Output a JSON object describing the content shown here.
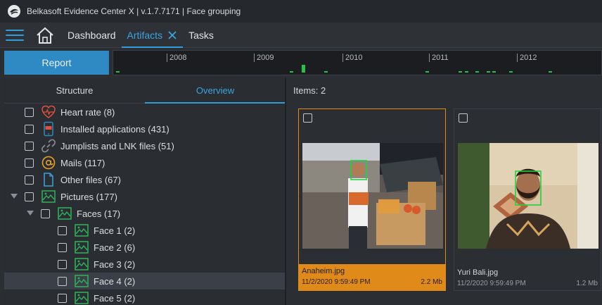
{
  "window": {
    "title": "Belkasoft Evidence Center X | v.1.7.7171 | Face grouping"
  },
  "nav": {
    "tabs": [
      {
        "label": "Dashboard"
      },
      {
        "label": "Artifacts"
      },
      {
        "label": "Tasks"
      }
    ]
  },
  "toolbar": {
    "report_label": "Report"
  },
  "timeline": {
    "years": [
      "2008",
      "2009",
      "2010",
      "2011",
      "2012"
    ],
    "bar_color": "#25c24a"
  },
  "left": {
    "tabs": [
      {
        "label": "Structure"
      },
      {
        "label": "Overview"
      }
    ],
    "tree": [
      {
        "label": "Heart rate (8)"
      },
      {
        "label": "Installed applications (431)"
      },
      {
        "label": "Jumplists and LNK files (51)"
      },
      {
        "label": "Mails (117)"
      },
      {
        "label": "Other files (67)"
      },
      {
        "label": "Pictures (177)"
      },
      {
        "label": "Faces (17)"
      },
      {
        "label": "Face 1 (2)"
      },
      {
        "label": "Face 2 (6)"
      },
      {
        "label": "Face 3 (2)"
      },
      {
        "label": "Face 4 (2)"
      },
      {
        "label": "Face 5 (2)"
      }
    ]
  },
  "right": {
    "items_label": "Items: 2",
    "cards": [
      {
        "filename": "Anaheim.jpg",
        "date": "11/2/2020 9:59:49 PM",
        "size": "2.2 Mb"
      },
      {
        "filename": "Yuri Bali.jpg",
        "date": "11/2/2020 9:59:49 PM",
        "size": "1.2 Mb"
      }
    ]
  },
  "colors": {
    "accent": "#2f9fdc",
    "selection": "#e08a1a",
    "face_box": "#23d13c"
  }
}
